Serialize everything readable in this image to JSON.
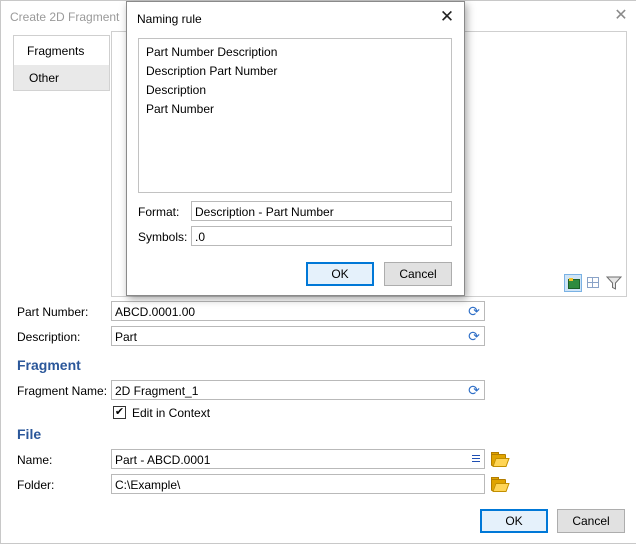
{
  "window": {
    "title": "Create 2D Fragment",
    "close_glyph": "✕"
  },
  "tabs": [
    {
      "label": "Fragments",
      "active": true
    },
    {
      "label": "Other",
      "active": false
    }
  ],
  "view_buttons": [
    {
      "icon": "image-view-icon",
      "active": true
    },
    {
      "icon": "grid-view-icon",
      "active": false
    },
    {
      "icon": "filter-icon",
      "active": false
    }
  ],
  "fields": {
    "part_number": {
      "label": "Part Number:",
      "value": "ABCD.0001.00"
    },
    "description": {
      "label": "Description:",
      "value": "Part"
    }
  },
  "fragment": {
    "heading": "Fragment",
    "name_label": "Fragment Name:",
    "name_value": "2D Fragment_1",
    "edit_in_context_label": "Edit in Context",
    "edit_in_context_checked": true,
    "check_glyph": "✔"
  },
  "file": {
    "heading": "File",
    "name_label": "Name:",
    "name_value": "Part - ABCD.0001",
    "folder_label": "Folder:",
    "folder_value": "C:\\Example\\"
  },
  "buttons": {
    "ok": "OK",
    "cancel": "Cancel"
  },
  "naming_dialog": {
    "title": "Naming rule",
    "close_glyph": "✕",
    "options": [
      "Part Number Description",
      "Description Part Number",
      "Description",
      "Part Number"
    ],
    "format_label": "Format:",
    "format_value": "Description - Part Number",
    "symbols_label": "Symbols:",
    "symbols_value": ".0",
    "ok": "OK",
    "cancel": "Cancel"
  },
  "colors": {
    "section_heading": "#2b579a",
    "default_button_border": "#0078d7",
    "refresh_icon": "#2f6fc7"
  }
}
